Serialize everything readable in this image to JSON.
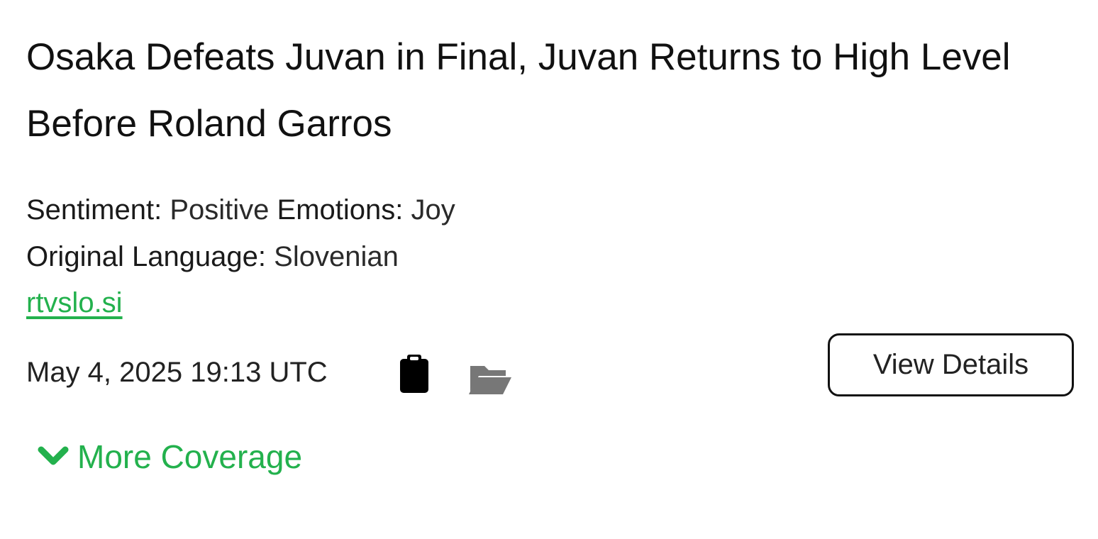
{
  "article": {
    "title": "Osaka Defeats Juvan in Final, Juvan Returns to High Level Before Roland Garros",
    "sentiment_label": "Sentiment:",
    "sentiment_value": "Positive",
    "emotions_label": "Emotions:",
    "emotions_value": "Joy",
    "language_label": "Original Language:",
    "language_value": "Slovenian",
    "source": "rtvslo.si",
    "timestamp": "May 4, 2025 19:13 UTC",
    "view_details_label": "View Details",
    "more_coverage_label": "More Coverage"
  },
  "icons": {
    "copy": "clipboard-icon",
    "save": "folder-open-icon",
    "expand": "chevron-down-icon"
  },
  "colors": {
    "accent": "#23b14d",
    "text": "#111111",
    "folder_icon": "#777777"
  }
}
